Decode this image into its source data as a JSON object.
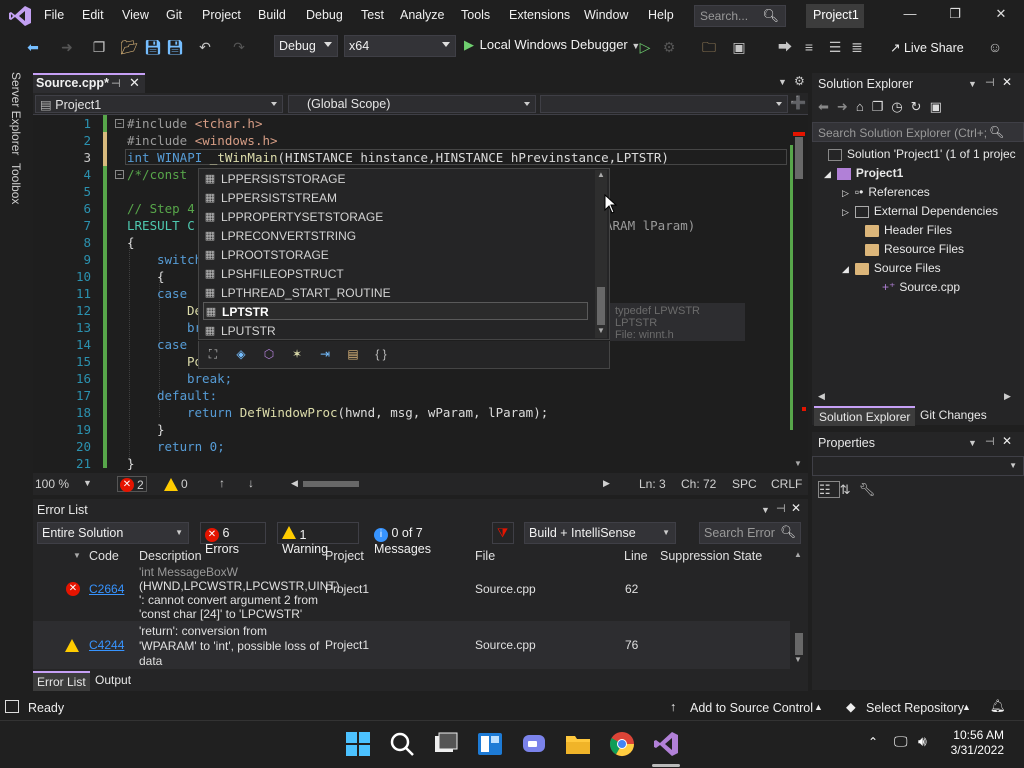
{
  "menu": {
    "items": [
      "File",
      "Edit",
      "View",
      "Git",
      "Project",
      "Build",
      "Debug",
      "Test",
      "Analyze",
      "Tools",
      "Extensions",
      "Window",
      "Help"
    ],
    "search_placeholder": "Search...",
    "project_title": "Project1"
  },
  "toolbar": {
    "config": "Debug",
    "platform": "x64",
    "debugger": "Local Windows Debugger",
    "live_share": "Live Share"
  },
  "side_tabs": {
    "server_explorer": "Server Explorer",
    "toolbox": "Toolbox"
  },
  "doc_tab": {
    "label": "Source.cpp*"
  },
  "navbar": {
    "project": "Project1",
    "scope": "(Global Scope)"
  },
  "editor": {
    "line_numbers": [
      "1",
      "2",
      "3",
      "4",
      "5",
      "6",
      "7",
      "8",
      "9",
      "10",
      "11",
      "12",
      "13",
      "14",
      "15",
      "16",
      "17",
      "18",
      "19",
      "20",
      "21"
    ],
    "zoom": "100 %",
    "errors": "2",
    "warnings": "0",
    "ln": "Ln: 3",
    "ch": "Ch: 72",
    "spc": "SPC",
    "crlf": "CRLF"
  },
  "code": {
    "l1a": "#include ",
    "l1b": "<tchar.h>",
    "l2a": "#include ",
    "l2b": "<windows.h>",
    "l3a": "int",
    "l3b": " WINAPI ",
    "l3c": "_tWinMain",
    "l3d": "(HINSTANCE hinstance,HINSTANCE hPrevinstance,LPTSTR)",
    "l4": "/*/const",
    "l6": "// Step 4",
    "l7a": "LRESULT C",
    "l7b": "ARAM lParam)",
    "l8": "{",
    "l9": "switch",
    "l10": "{",
    "l11": "case",
    "l12": "De",
    "l13": "br",
    "l14": "case",
    "l15": "Po",
    "l16": "break;",
    "l17": "default:",
    "l18a": "return ",
    "l18b": "DefWindowProc",
    "l18c": "(hwnd, msg, wParam, lParam);",
    "l19": "}",
    "l20": "return 0;",
    "l21": "}"
  },
  "intellisense": {
    "items": [
      "LPPERSISTSTORAGE",
      "LPPERSISTSTREAM",
      "LPPROPERTYSETSTORAGE",
      "LPRECONVERTSTRING",
      "LPROOTSTORAGE",
      "LPSHFILEOPSTRUCT",
      "LPTHREAD_START_ROUTINE",
      "LPTSTR",
      "LPUTSTR"
    ],
    "selected_index": 7,
    "info_line1": "typedef LPWSTR LPTSTR",
    "info_line2": "File: winnt.h"
  },
  "solution_explorer": {
    "title": "Solution Explorer",
    "search_placeholder": "Search Solution Explorer (Ctrl+;",
    "solution_label": "Solution 'Project1' (1 of 1 projec",
    "project": "Project1",
    "nodes": [
      "References",
      "External Dependencies",
      "Header Files",
      "Resource Files",
      "Source Files",
      "Source.cpp"
    ],
    "tab_solution": "Solution Explorer",
    "tab_git": "Git Changes"
  },
  "properties": {
    "title": "Properties"
  },
  "error_list": {
    "title": "Error List",
    "scope": "Entire Solution",
    "errors_btn": "6 Errors",
    "warning_btn": "1 Warning",
    "messages_btn": "0 of 7 Messages",
    "build": "Build + IntelliSense",
    "search_placeholder": "Search Error",
    "headers": [
      "Code",
      "Description",
      "Project",
      "File",
      "Line",
      "Suppression State"
    ],
    "rows": [
      {
        "code": "C2664",
        "desc1": "'int MessageBoxW",
        "desc2": "(HWND,LPCWSTR,LPCWSTR,UINT)",
        "desc3": "': cannot convert argument 2 from",
        "desc4": "'const char [24]' to 'LPCWSTR'",
        "project": "Project1",
        "file": "Source.cpp",
        "line": "62"
      },
      {
        "code": "C4244",
        "desc1": "'return': conversion from",
        "desc2": "'WPARAM' to 'int', possible loss of",
        "desc3": "data",
        "project": "Project1",
        "file": "Source.cpp",
        "line": "76"
      }
    ],
    "tab_errors": "Error List",
    "tab_output": "Output"
  },
  "statusbar": {
    "ready": "Ready",
    "source_control": "Add to Source Control",
    "repository": "Select Repository"
  },
  "taskbar": {
    "time": "10:56 AM",
    "date": "3/31/2022"
  }
}
